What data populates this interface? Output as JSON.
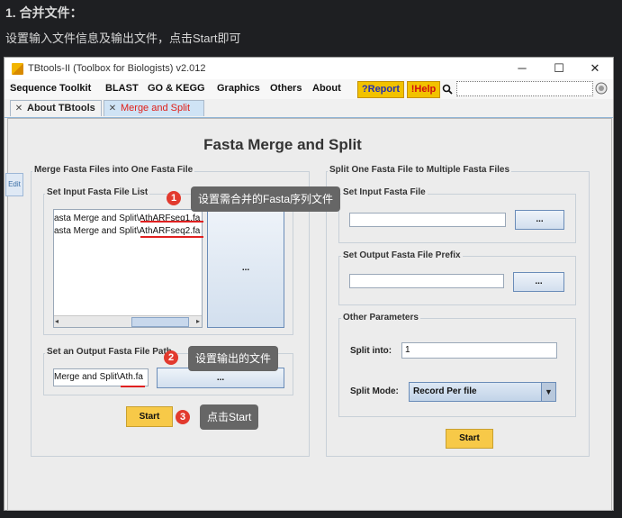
{
  "doc": {
    "heading": "1. 合并文件：",
    "instruction": "设置输入文件信息及输出文件，点击Start即可"
  },
  "window": {
    "title": "TBtools-II (Toolbox for Biologists) v2.012",
    "minimize": "─",
    "maximize": "☐",
    "close": "✕"
  },
  "menu": {
    "items": [
      "Sequence Toolkit",
      "BLAST",
      "GO & KEGG",
      "Graphics",
      "Others",
      "About"
    ],
    "report": "?Report",
    "help": "!Help"
  },
  "tabs": [
    {
      "label": "About TBtools",
      "close": "✕"
    },
    {
      "label": "Merge and Split",
      "close": "✕"
    }
  ],
  "main_title": "Fasta Merge and Split",
  "merge": {
    "group_label": "Merge Fasta Files into One Fasta File",
    "input_label": "Set Input Fasta File List",
    "files": [
      {
        "prefix": "asta Merge and Split\\",
        "name": "AthARFseq1.fa"
      },
      {
        "prefix": "asta Merge and Split\\",
        "name": "AthARFseq2.fa"
      }
    ],
    "browse": "...",
    "output_label": "Set an Output Fasta File Path",
    "output_prefix": "Merge and Split\\",
    "output_name": "Ath.fa",
    "output_browse": "...",
    "start": "Start"
  },
  "split": {
    "group_label": "Split One Fasta File to Multiple Fasta Files",
    "input_label": "Set Input Fasta File",
    "input_browse": "...",
    "output_label": "Set Output Fasta File Prefix",
    "output_browse": "...",
    "params_label": "Other Parameters",
    "split_into_label": "Split into:",
    "split_into_value": "1",
    "split_mode_label": "Split Mode:",
    "split_mode_value": "Record Per file",
    "start": "Start"
  },
  "annotations": [
    {
      "num": "1",
      "text": "设置需合并的Fasta序列文件"
    },
    {
      "num": "2",
      "text": "设置输出的文件"
    },
    {
      "num": "3",
      "text": "点击Start"
    }
  ],
  "side_badge": "Edit",
  "colors": {
    "accent_yellow": "#f2c200",
    "start_button": "#f7c948",
    "annotation_red": "#e23a2e",
    "tab_active_text": "#e0201a"
  }
}
